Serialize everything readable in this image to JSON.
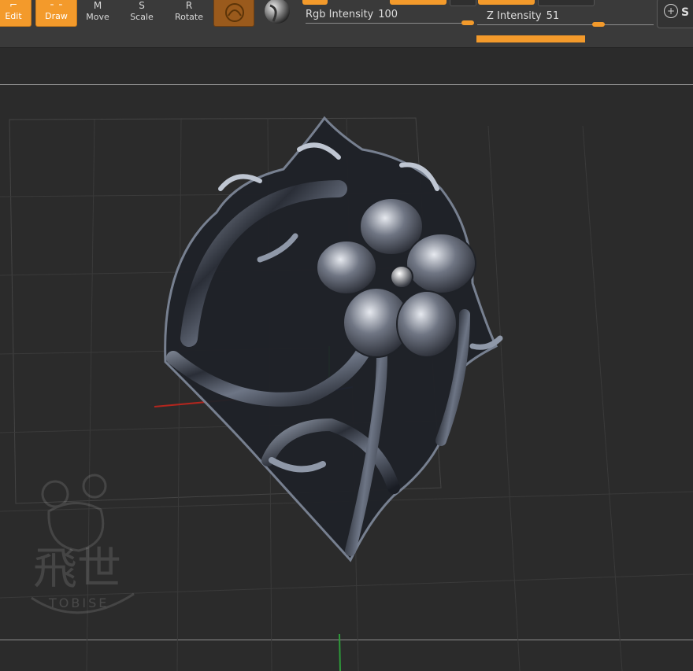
{
  "toolbar": {
    "edit_label": "Edit",
    "draw_label": "Draw",
    "move_label": "Move",
    "scale_label": "Scale",
    "rotate_label": "Rotate",
    "move_glyph": "M",
    "scale_glyph": "S",
    "rotate_glyph": "R",
    "material_icon": "material-sphere-icon",
    "sphere_icon": "matcap-sphere-icon",
    "snapshot_glyph": "S"
  },
  "sliders": {
    "rgb": {
      "label": "Rgb Intensity",
      "value": "100",
      "fraction": 1.0
    },
    "z": {
      "label": "Z Intensity",
      "value": "51",
      "fraction": 0.51
    }
  },
  "colors": {
    "accent": "#f39a2b",
    "panel": "#3a3a3a",
    "canvas": "#2b2b2b",
    "axis_x": "#b3261e",
    "axis_y": "#2e9a3a",
    "axis_z": "#3148b8"
  },
  "watermark": {
    "cjk": "飛世",
    "latin": "TOBISE"
  }
}
